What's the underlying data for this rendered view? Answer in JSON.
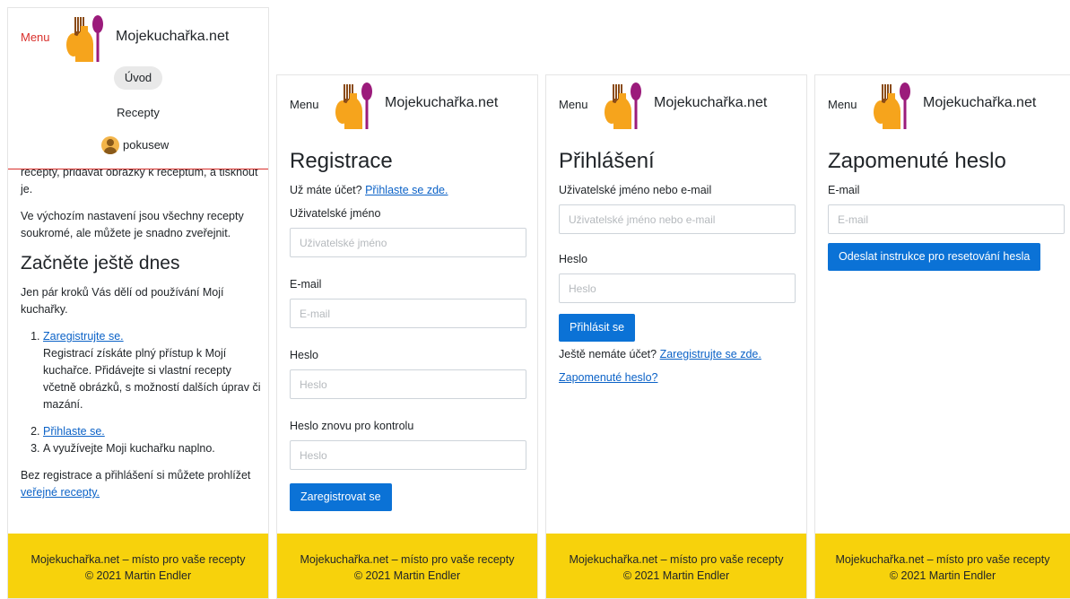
{
  "brand": "Mojekuchařka.net",
  "menu_label": "Menu",
  "footer": {
    "line1": "Mojekuchařka.net – místo pro vaše recepty",
    "line2": "© 2021 Martin Endler"
  },
  "nav": {
    "home": "Úvod",
    "recipes": "Recepty",
    "user": "pokusew"
  },
  "home": {
    "p1": "recepty, přidávat obrázky k receptům, a tisknout je.",
    "p2": "Ve výchozím nastavení jsou všechny recepty soukromé, ale můžete je snadno zveřejnit.",
    "heading": "Začněte ještě dnes",
    "intro": "Jen pár kroků Vás dělí od používání Mojí kuchařky.",
    "steps": [
      {
        "link": "Zaregistrujte se.",
        "text": "Registrací získáte plný přístup k Mojí kuchařce. Přidávejte si vlastní recepty včetně obrázků, s možností dalších úprav či mazání."
      },
      {
        "link": "Přihlaste se.",
        "text": ""
      },
      {
        "link": "",
        "text": "A využívejte Moji kuchařku naplno."
      }
    ],
    "outro": "Bez registrace a přihlášení si můžete prohlížet",
    "outro_link": "veřejné recepty."
  },
  "register": {
    "title": "Registrace",
    "have_account": "Už máte účet?",
    "login_link": "Přihlaste se zde.",
    "username_label": "Uživatelské jméno",
    "username_placeholder": "Uživatelské jméno",
    "email_label": "E-mail",
    "email_placeholder": "E-mail",
    "password_label": "Heslo",
    "password_placeholder": "Heslo",
    "password2_label": "Heslo znovu pro kontrolu",
    "password2_placeholder": "Heslo",
    "submit": "Zaregistrovat se"
  },
  "login": {
    "title": "Přihlášení",
    "user_label": "Uživatelské jméno nebo e-mail",
    "user_placeholder": "Uživatelské jméno nebo e-mail",
    "password_label": "Heslo",
    "password_placeholder": "Heslo",
    "submit": "Přihlásit se",
    "no_account": "Ještě nemáte účet?",
    "register_link": "Zaregistrujte se zde.",
    "forgot_link": "Zapomenuté heslo?"
  },
  "forgot": {
    "title": "Zapomenuté heslo",
    "email_label": "E-mail",
    "email_placeholder": "E-mail",
    "submit": "Odeslat instrukce pro resetování hesla"
  },
  "colors": {
    "accent": "#0b72d6",
    "footer": "#f7d20c",
    "active_menu": "#d9302c"
  }
}
